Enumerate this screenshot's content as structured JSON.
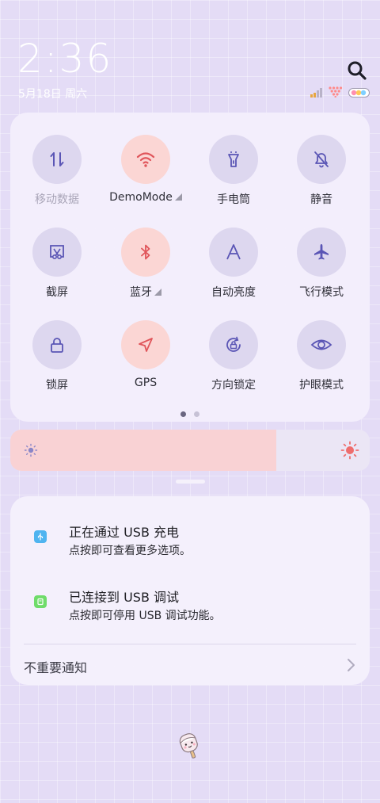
{
  "status": {
    "time": "2:36",
    "date": "5月18日 周六"
  },
  "icons": {
    "search": "search-icon",
    "signal": "signal-icon",
    "wifi_status": "wifi-status-icon",
    "battery": "battery-icon"
  },
  "quick_settings": {
    "tiles": [
      {
        "label": "移动数据",
        "icon": "mobile-data-icon",
        "state": "off"
      },
      {
        "label": "DemoMode",
        "icon": "wifi-icon",
        "state": "on"
      },
      {
        "label": "手电筒",
        "icon": "flashlight-icon",
        "state": "off"
      },
      {
        "label": "静音",
        "icon": "mute-icon",
        "state": "off"
      },
      {
        "label": "截屏",
        "icon": "screenshot-icon",
        "state": "off"
      },
      {
        "label": "蓝牙",
        "icon": "bluetooth-icon",
        "state": "on"
      },
      {
        "label": "自动亮度",
        "icon": "auto-brightness-icon",
        "state": "off"
      },
      {
        "label": "飞行模式",
        "icon": "airplane-icon",
        "state": "off"
      },
      {
        "label": "锁屏",
        "icon": "lock-icon",
        "state": "off"
      },
      {
        "label": "GPS",
        "icon": "gps-icon",
        "state": "on"
      },
      {
        "label": "方向锁定",
        "icon": "rotation-lock-icon",
        "state": "off"
      },
      {
        "label": "护眼模式",
        "icon": "eye-icon",
        "state": "off"
      }
    ],
    "page_count": 2,
    "current_page": 1
  },
  "brightness": {
    "level": 0.74
  },
  "notifications": [
    {
      "title": "正在通过 USB 充电",
      "desc": "点按即可查看更多选项。",
      "icon": "usb-icon"
    },
    {
      "title": "已连接到 USB 调试",
      "desc": "点按即可停用 USB 调试功能。",
      "icon": "usb-debug-icon"
    }
  ],
  "minor_notifications": {
    "label": "不重要通知"
  },
  "colors": {
    "accent": "#5a55b5",
    "active_tile": "#fbd6d4",
    "active_icon": "#e0555a",
    "background": "#e4dcf6"
  }
}
